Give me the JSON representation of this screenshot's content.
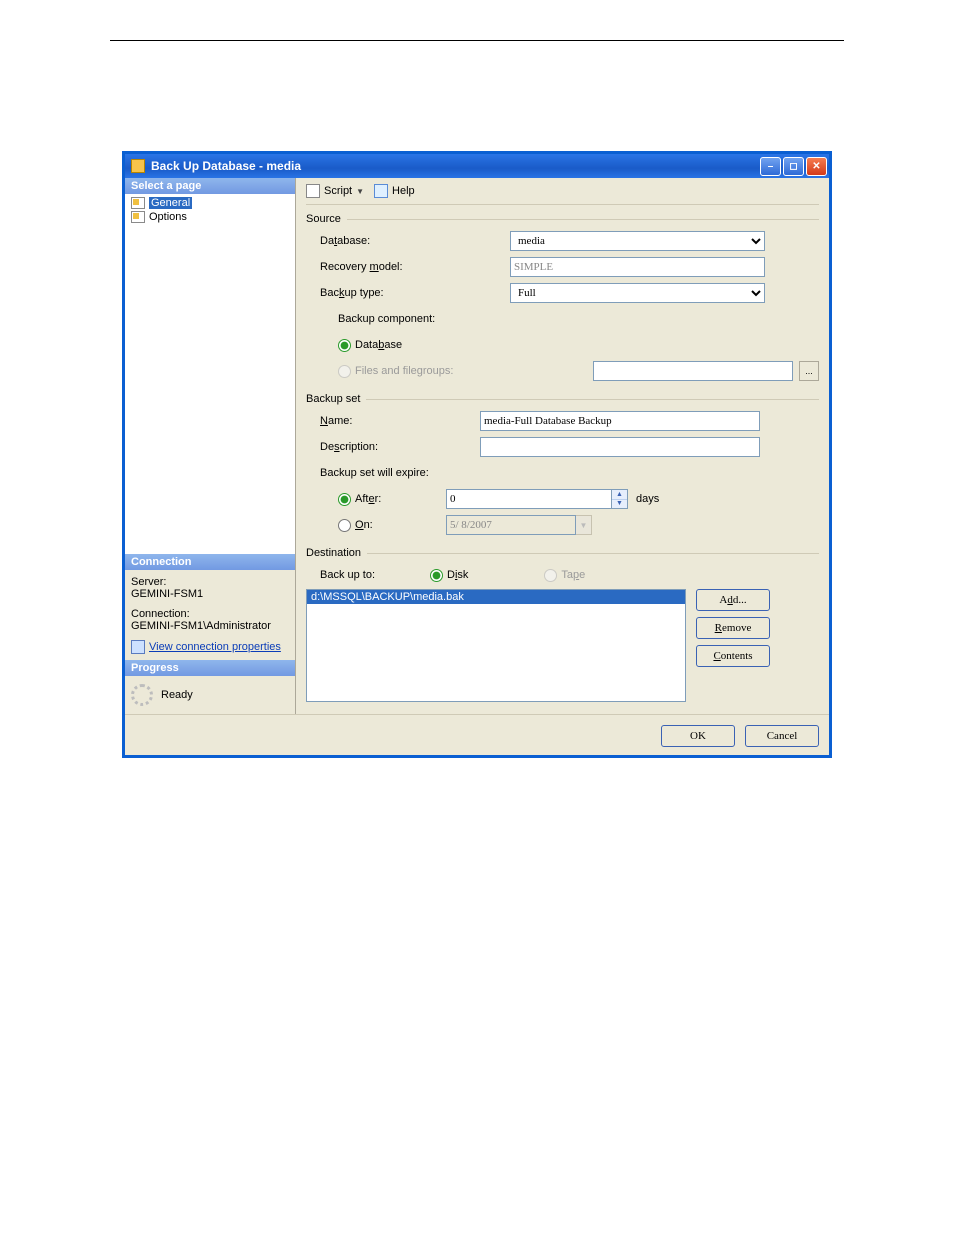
{
  "window": {
    "title": "Back Up Database - media"
  },
  "sidebar": {
    "select_header": "Select a page",
    "pages": [
      {
        "label": "General",
        "selected": true
      },
      {
        "label": "Options",
        "selected": false
      }
    ],
    "connection_header": "Connection",
    "server_label": "Server:",
    "server_value": "GEMINI-FSM1",
    "connection_label": "Connection:",
    "connection_value": "GEMINI-FSM1\\Administrator",
    "view_conn_link": "View connection properties",
    "progress_header": "Progress",
    "progress_status": "Ready"
  },
  "toolbar": {
    "script_label": "Script",
    "help_label": "Help"
  },
  "source": {
    "section": "Source",
    "database_label": "Database:",
    "database_value": "media",
    "recovery_label": "Recovery model:",
    "recovery_value": "SIMPLE",
    "backup_type_label": "Backup type:",
    "backup_type_value": "Full",
    "component_label": "Backup component:",
    "component_database": "Database",
    "component_files": "Files and filegroups:"
  },
  "backup_set": {
    "section": "Backup set",
    "name_label": "Name:",
    "name_value": "media-Full Database Backup",
    "description_label": "Description:",
    "description_value": "",
    "expire_label": "Backup set will expire:",
    "after_label": "After:",
    "after_value": "0",
    "after_unit": "days",
    "on_label": "On:",
    "on_value": "5/ 8/2007"
  },
  "destination": {
    "section": "Destination",
    "backup_to_label": "Back up to:",
    "disk_label": "Disk",
    "tape_label": "Tape",
    "paths": [
      "d:\\MSSQL\\BACKUP\\media.bak"
    ],
    "add_btn": "Add...",
    "remove_btn": "Remove",
    "contents_btn": "Contents"
  },
  "footer": {
    "ok": "OK",
    "cancel": "Cancel"
  }
}
